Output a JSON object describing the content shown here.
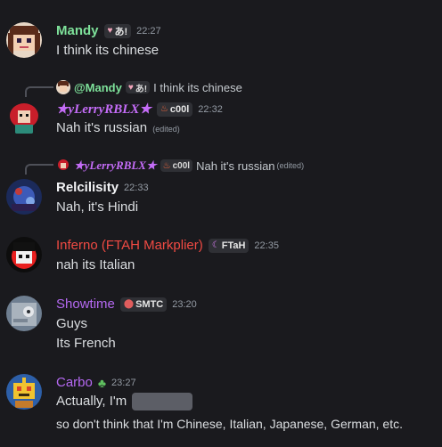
{
  "messages": [
    {
      "username": "Mandy",
      "color": "#7ee19a",
      "tag": {
        "icon": "heart-icon",
        "label": "あ!"
      },
      "timestamp": "22:27",
      "lines": [
        "I think its chinese"
      ]
    },
    {
      "reply": {
        "name": "@Mandy",
        "name_color": "#7ee19a",
        "tag": "あ!",
        "text": "I think its chinese"
      },
      "username": "★yLerryRBLX★",
      "color": "#c46cf7",
      "tag": {
        "icon": "fire-icon",
        "label": "c00l"
      },
      "timestamp": "22:32",
      "lines": [
        "Nah it's russian"
      ],
      "edited": "(edited)"
    },
    {
      "reply": {
        "name": "★yLerryRBLX★",
        "name_color": "#c46cf7",
        "tag": "c00l",
        "text": "Nah it's russian",
        "edited": "(edited)"
      },
      "username": "Relcilisity",
      "color": "#f2f3f5",
      "timestamp": "22:33",
      "lines": [
        "Nah, it's Hindi"
      ]
    },
    {
      "username": "Inferno (FTAH Markplier)",
      "color": "#f04a43",
      "tag": {
        "icon": "crescent-icon",
        "label": "FTaH"
      },
      "timestamp": "22:35",
      "lines": [
        "nah its Italian"
      ]
    },
    {
      "username": "Showtime",
      "color": "#b569f2",
      "tag": {
        "icon": "mushroom-icon",
        "label": "SMTC"
      },
      "timestamp": "23:20",
      "lines": [
        "Guys",
        "Its French"
      ]
    },
    {
      "username": "Carbo",
      "color": "#b569f2",
      "timestamp": "23:27",
      "lines": [
        "Actually, I'm",
        "so don't think that I'm Chinese, Italian, Japanese, German, etc."
      ]
    }
  ]
}
